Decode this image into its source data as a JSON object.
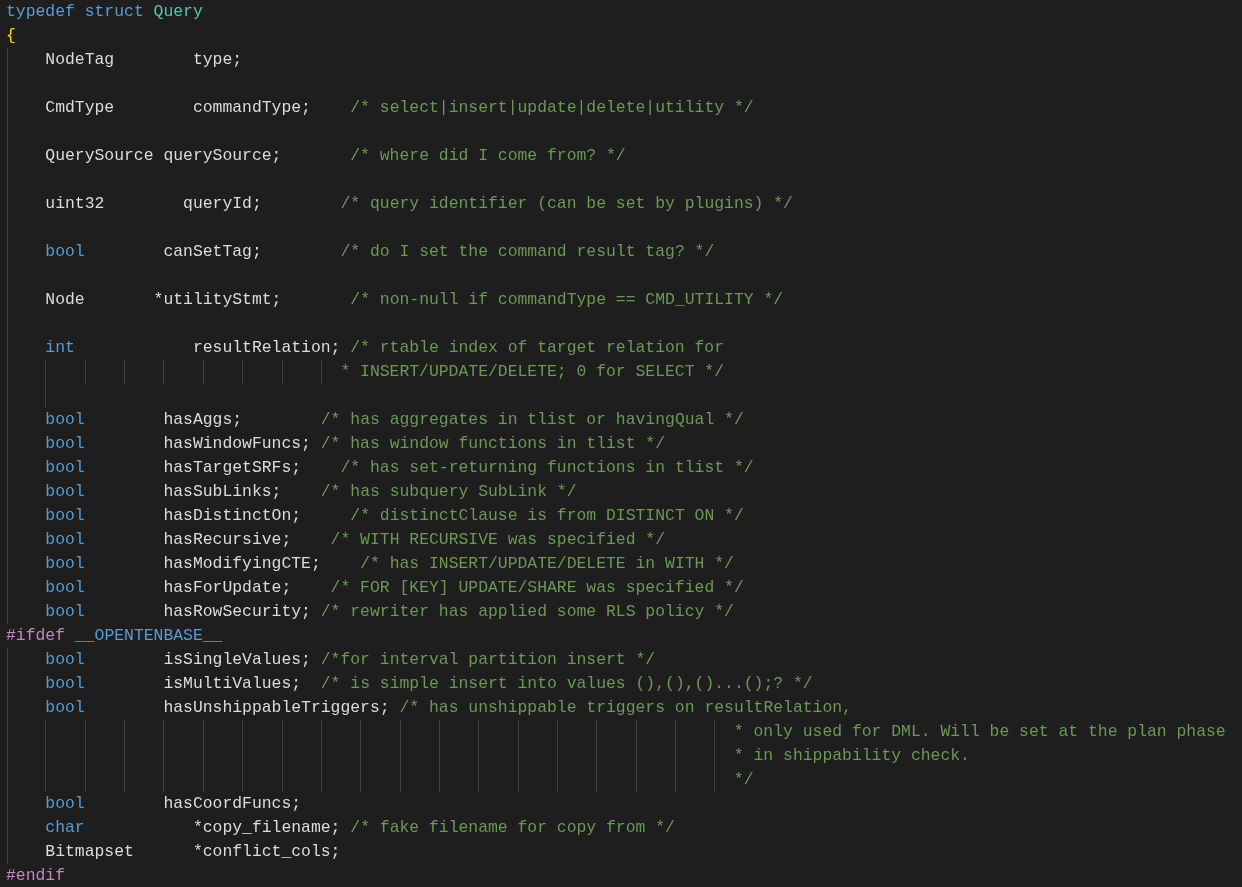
{
  "editor": {
    "lines": [
      {
        "tokens": [
          {
            "kind": "keyword",
            "text": "typedef"
          },
          {
            "kind": "keyword",
            "text": " struct"
          },
          {
            "kind": "type",
            "text": " Query"
          }
        ]
      },
      {
        "tokens": [
          {
            "kind": "brace",
            "text": "{"
          }
        ]
      },
      {
        "tokens": [
          {
            "kind": "plain",
            "text": "    NodeTag"
          },
          {
            "kind": "plain",
            "text": "        type;"
          }
        ],
        "blank_line_after": true
      },
      {
        "tokens": [
          {
            "kind": "plain",
            "text": "    CmdType"
          },
          {
            "kind": "plain",
            "text": "        commandType;"
          },
          {
            "kind": "comment",
            "text": "    /* select|insert|update|delete|utility */"
          }
        ],
        "blank_line_after": true
      },
      {
        "tokens": [
          {
            "kind": "plain",
            "text": "    QuerySource"
          },
          {
            "kind": "plain",
            "text": " querySource;"
          },
          {
            "kind": "comment",
            "text": "       /* where did I come from? */"
          }
        ],
        "blank_line_after": true
      },
      {
        "tokens": [
          {
            "kind": "plain",
            "text": "    uint32"
          },
          {
            "kind": "plain",
            "text": "        queryId;"
          },
          {
            "kind": "comment",
            "text": "        /* query identifier (can be set by plugins) */"
          }
        ],
        "blank_line_after": true
      },
      {
        "tokens": [
          {
            "kind": "keyword",
            "text": "    bool"
          },
          {
            "kind": "plain",
            "text": "        canSetTag;"
          },
          {
            "kind": "comment",
            "text": "        /* do I set the command result tag? */"
          }
        ],
        "blank_line_after": true
      },
      {
        "tokens": [
          {
            "kind": "plain",
            "text": "    Node"
          },
          {
            "kind": "plain",
            "text": "       *utilityStmt;"
          },
          {
            "kind": "comment",
            "text": "       /* non-null if commandType == CMD_UTILITY */"
          }
        ],
        "blank_line_after": true
      },
      {
        "tokens": [
          {
            "kind": "keyword",
            "text": "    int"
          },
          {
            "kind": "plain",
            "text": "            resultRelation;"
          },
          {
            "kind": "comment",
            "text": " /* rtable index of target relation for"
          }
        ]
      },
      {
        "tokens": [
          {
            "kind": "comment",
            "text": "                                  * INSERT/UPDATE/DELETE; 0 for SELECT */"
          }
        ],
        "blank_line_after": true
      },
      {
        "tokens": [
          {
            "kind": "keyword",
            "text": "    bool"
          },
          {
            "kind": "plain",
            "text": "        hasAggs;"
          },
          {
            "kind": "comment",
            "text": "        /* has aggregates in tlist or havingQual */"
          }
        ]
      },
      {
        "tokens": [
          {
            "kind": "keyword",
            "text": "    bool"
          },
          {
            "kind": "plain",
            "text": "        hasWindowFuncs;"
          },
          {
            "kind": "comment",
            "text": " /* has window functions in tlist */"
          }
        ]
      },
      {
        "tokens": [
          {
            "kind": "keyword",
            "text": "    bool"
          },
          {
            "kind": "plain",
            "text": "        hasTargetSRFs;"
          },
          {
            "kind": "comment",
            "text": "    /* has set-returning functions in tlist */"
          }
        ]
      },
      {
        "tokens": [
          {
            "kind": "keyword",
            "text": "    bool"
          },
          {
            "kind": "plain",
            "text": "        hasSubLinks;"
          },
          {
            "kind": "comment",
            "text": "    /* has subquery SubLink */"
          }
        ]
      },
      {
        "tokens": [
          {
            "kind": "keyword",
            "text": "    bool"
          },
          {
            "kind": "plain",
            "text": "        hasDistinctOn;"
          },
          {
            "kind": "comment",
            "text": "     /* distinctClause is from DISTINCT ON */"
          }
        ]
      },
      {
        "tokens": [
          {
            "kind": "keyword",
            "text": "    bool"
          },
          {
            "kind": "plain",
            "text": "        hasRecursive;"
          },
          {
            "kind": "comment",
            "text": "    /* WITH RECURSIVE was specified */"
          }
        ]
      },
      {
        "tokens": [
          {
            "kind": "keyword",
            "text": "    bool"
          },
          {
            "kind": "plain",
            "text": "        hasModifyingCTE;"
          },
          {
            "kind": "comment",
            "text": "    /* has INSERT/UPDATE/DELETE in WITH */"
          }
        ]
      },
      {
        "tokens": [
          {
            "kind": "keyword",
            "text": "    bool"
          },
          {
            "kind": "plain",
            "text": "        hasForUpdate;"
          },
          {
            "kind": "comment",
            "text": "    /* FOR [KEY] UPDATE/SHARE was specified */"
          }
        ]
      },
      {
        "tokens": [
          {
            "kind": "keyword",
            "text": "    bool"
          },
          {
            "kind": "plain",
            "text": "        hasRowSecurity;"
          },
          {
            "kind": "comment",
            "text": " /* rewriter has applied some RLS policy */"
          }
        ]
      },
      {
        "tokens": [
          {
            "kind": "preproc",
            "text": "#ifdef"
          },
          {
            "kind": "macro",
            "text": " __OPENTENBASE__"
          }
        ]
      },
      {
        "tokens": [
          {
            "kind": "keyword",
            "text": "    bool"
          },
          {
            "kind": "plain",
            "text": "        isSingleValues;"
          },
          {
            "kind": "comment",
            "text": " /*for interval partition insert */"
          }
        ]
      },
      {
        "tokens": [
          {
            "kind": "keyword",
            "text": "    bool"
          },
          {
            "kind": "plain",
            "text": "        isMultiValues;"
          },
          {
            "kind": "comment",
            "text": "  /* is simple insert into values (),(),()...();? */"
          }
        ]
      },
      {
        "tokens": [
          {
            "kind": "keyword",
            "text": "    bool"
          },
          {
            "kind": "plain",
            "text": "        hasUnshippableTriggers;"
          },
          {
            "kind": "comment",
            "text": " /* has unshippable triggers on resultRelation,"
          }
        ]
      },
      {
        "tokens": [
          {
            "kind": "comment",
            "text": "                                                                          * only used for DML. Will be set at the plan phase"
          }
        ]
      },
      {
        "tokens": [
          {
            "kind": "comment",
            "text": "                                                                          * in shippability check."
          }
        ]
      },
      {
        "tokens": [
          {
            "kind": "comment",
            "text": "                                                                          */"
          }
        ]
      },
      {
        "tokens": [
          {
            "kind": "keyword",
            "text": "    bool"
          },
          {
            "kind": "plain",
            "text": "        hasCoordFuncs;"
          }
        ]
      },
      {
        "tokens": [
          {
            "kind": "keyword",
            "text": "    char"
          },
          {
            "kind": "plain",
            "text": "           *copy_filename;"
          },
          {
            "kind": "comment",
            "text": " /* fake filename for copy from */"
          }
        ]
      },
      {
        "tokens": [
          {
            "kind": "plain",
            "text": "    Bitmapset"
          },
          {
            "kind": "plain",
            "text": "      *conflict_cols;"
          }
        ]
      },
      {
        "tokens": [
          {
            "kind": "preproc",
            "text": "#endif"
          }
        ]
      }
    ]
  }
}
